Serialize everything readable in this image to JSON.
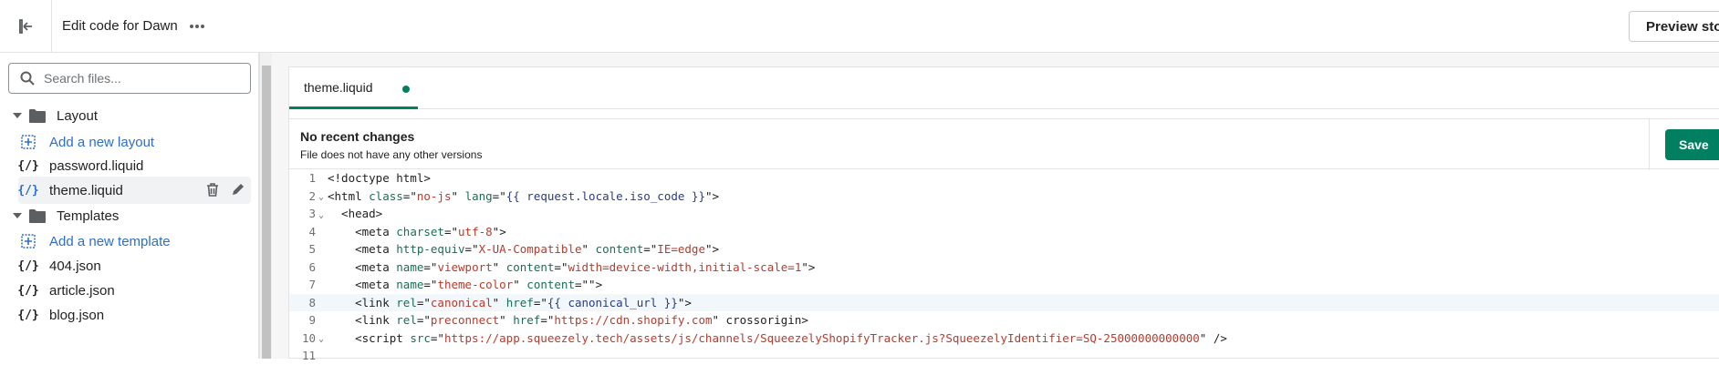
{
  "topbar": {
    "title": "Edit code for Dawn",
    "preview_label": "Preview store"
  },
  "sidebar": {
    "search_placeholder": "Search files...",
    "folders": [
      {
        "label": "Layout",
        "add_label": "Add a new layout",
        "files": [
          "password.liquid",
          "theme.liquid"
        ]
      },
      {
        "label": "Templates",
        "add_label": "Add a new template",
        "files": [
          "404.json",
          "article.json",
          "blog.json"
        ]
      }
    ],
    "selected_file": "theme.liquid",
    "file_icon_glyph": "{/}"
  },
  "editor": {
    "tab_label": "theme.liquid",
    "changes_title": "No recent changes",
    "changes_subtitle": "File does not have any other versions",
    "save_label": "Save",
    "active_line": 8,
    "lines": [
      {
        "n": "1",
        "fold": "",
        "text": "<!doctype html>"
      },
      {
        "n": "2",
        "fold": "⌄",
        "text": "<html class=\"no-js\" lang=\"{{ request.locale.iso_code }}\">"
      },
      {
        "n": "3",
        "fold": "⌄",
        "text": "  <head>"
      },
      {
        "n": "4",
        "fold": "",
        "text": "    <meta charset=\"utf-8\">"
      },
      {
        "n": "5",
        "fold": "",
        "text": "    <meta http-equiv=\"X-UA-Compatible\" content=\"IE=edge\">"
      },
      {
        "n": "6",
        "fold": "",
        "text": "    <meta name=\"viewport\" content=\"width=device-width,initial-scale=1\">"
      },
      {
        "n": "7",
        "fold": "",
        "text": "    <meta name=\"theme-color\" content=\"\">"
      },
      {
        "n": "8",
        "fold": "",
        "text": "    <link rel=\"canonical\" href=\"{{ canonical_url }}\">"
      },
      {
        "n": "9",
        "fold": "",
        "text": "    <link rel=\"preconnect\" href=\"https://cdn.shopify.com\" crossorigin>"
      },
      {
        "n": "10",
        "fold": "⌄",
        "text": "    <script src=\"https://app.squeezely.tech/assets/js/channels/SqueezelyShopifyTracker.js?SqueezelyIdentifier=SQ-25000000000000\" />"
      },
      {
        "n": "11",
        "fold": "",
        "text": ""
      }
    ]
  },
  "colors": {
    "accent": "#008060",
    "link": "#2c6ecb",
    "attr": "#1a6e54",
    "string": "#b83a2c"
  }
}
